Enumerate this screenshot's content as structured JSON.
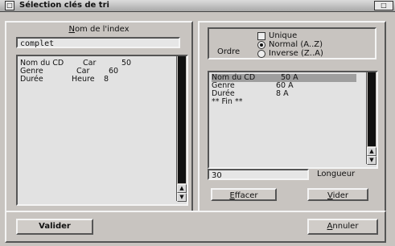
{
  "window": {
    "title": "Sélection clés de tri",
    "system_menu_glyph": "□",
    "right_button_glyph": "□"
  },
  "left": {
    "index_label_underlined": "N",
    "index_label_rest": "om de l'index",
    "index_value": "complet",
    "fields": [
      {
        "name": "Nom du CD",
        "type": "Car",
        "size": "50"
      },
      {
        "name": "Genre",
        "type": "Car",
        "size": "60"
      },
      {
        "name": "Durée",
        "type": "Heure",
        "size": "8"
      }
    ]
  },
  "right": {
    "order_label": "Ordre",
    "options": {
      "unique": "Unique",
      "normal": "Normal (A..Z)",
      "inverse": "Inverse (Z..A)"
    },
    "selected_order": "normal",
    "keys": [
      {
        "name": "Nom du CD",
        "value": "50 A"
      },
      {
        "name": "Genre",
        "value": "60 A"
      },
      {
        "name": "Durée",
        "value": "8 A"
      },
      {
        "name": "** Fin **",
        "value": ""
      }
    ],
    "length_value": "30",
    "length_label": "Longueur",
    "effacer_u": "E",
    "effacer_rest": "ffacer",
    "vider_u": "V",
    "vider_rest": "ider"
  },
  "footer": {
    "validate": "Valider",
    "cancel_u": "A",
    "cancel_rest": "nnuler"
  }
}
